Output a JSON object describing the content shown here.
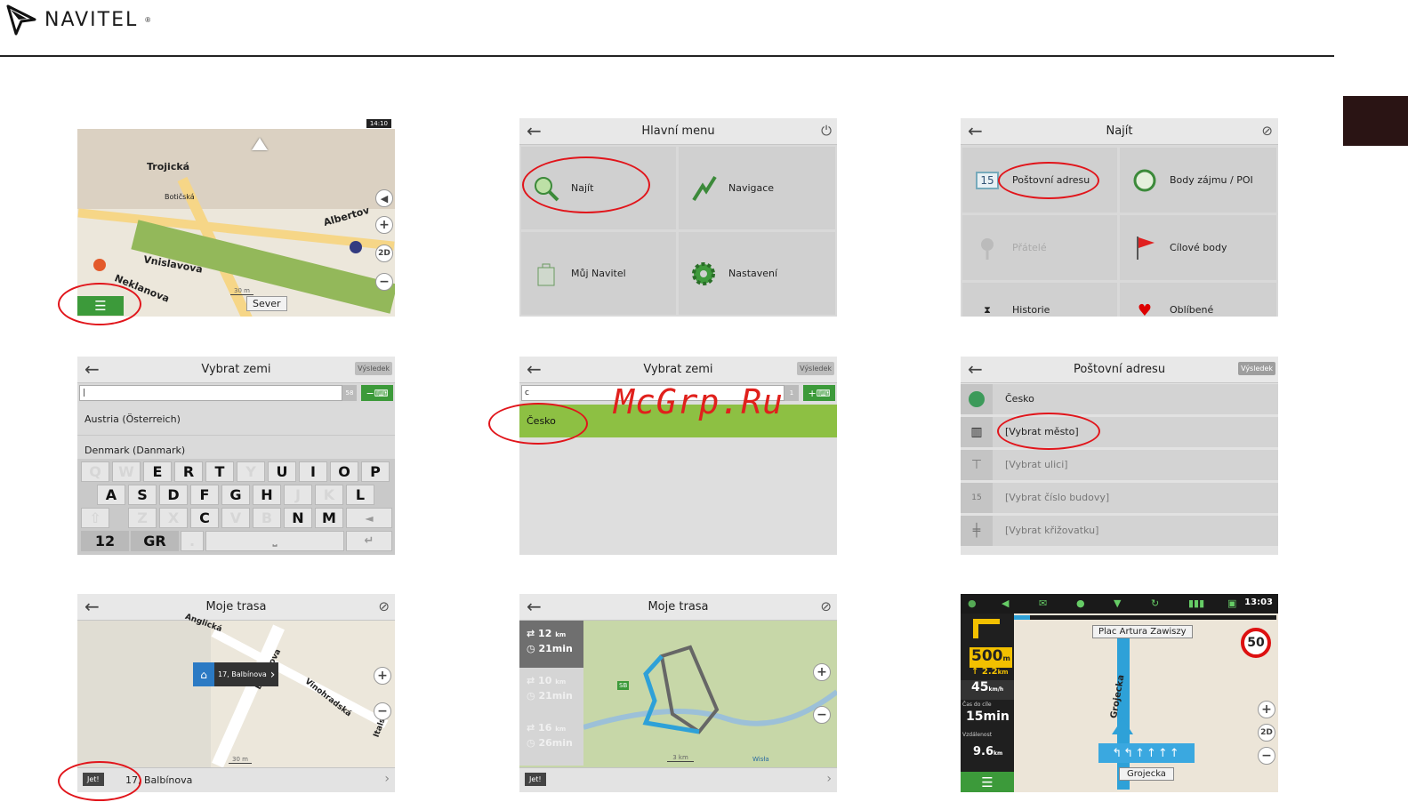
{
  "brand": {
    "name": "NAVITEL",
    "reg": "®"
  },
  "watermark": "McGrp.Ru",
  "p1": {
    "status_time": "14:10",
    "labels": [
      "Trojická",
      "Albertov",
      "Vnislavova",
      "Neklanova",
      "Botičská"
    ],
    "scale": "30 m",
    "sever": "Sever",
    "btn_2d": "2D"
  },
  "p2": {
    "title": "Hlavní menu",
    "tiles": [
      "Najít",
      "Navigace",
      "Můj Navitel",
      "Nastavení"
    ]
  },
  "p3": {
    "title": "Najít",
    "tiles": [
      "Poštovní adresu",
      "Body zájmu / POI",
      "Přátelé",
      "Cílové body",
      "Historie",
      "Oblíbené"
    ],
    "badge": "15"
  },
  "p4": {
    "title": "Vybrat zemi",
    "result_btn": "Výsledek",
    "input": "|",
    "count": "58",
    "items": [
      "Austria (Österreich)",
      "Denmark (Danmark)"
    ],
    "rows": [
      [
        "Q",
        "W",
        "E",
        "R",
        "T",
        "Y",
        "U",
        "I",
        "O",
        "P"
      ],
      [
        "A",
        "S",
        "D",
        "F",
        "G",
        "H",
        "J",
        "K",
        "L"
      ],
      [
        "⇧",
        "Z",
        "X",
        "C",
        "V",
        "B",
        "N",
        "M",
        "◄"
      ],
      [
        "12",
        "GR",
        ".",
        "⎵",
        "↵"
      ]
    ]
  },
  "p5": {
    "title": "Vybrat zemi",
    "result_btn": "Výsledek",
    "input": "c",
    "count": "1",
    "item": "Česko"
  },
  "p6": {
    "title": "Poštovní adresu",
    "result_btn": "Výsledek",
    "rows": [
      "Česko",
      "[Vybrat město]",
      "[Vybrat ulici]",
      "[Vybrat číslo budovy]",
      "[Vybrat křižovatku]"
    ]
  },
  "p7": {
    "title": "Moje trasa",
    "popup": "17, Balbínova",
    "labels": [
      "Balbínova",
      "Vinohradská",
      "Italská",
      "Anglická"
    ],
    "go": "Jet!",
    "address": "17, Balbínova",
    "scale": "30 m"
  },
  "p8": {
    "title": "Moje trasa",
    "routes": [
      {
        "dist": "12",
        "unit": "km",
        "time": "21min"
      },
      {
        "dist": "10",
        "unit": "km",
        "time": "21min"
      },
      {
        "dist": "16",
        "unit": "km",
        "time": "26min"
      }
    ],
    "go": "Jet!",
    "scale": "3 km",
    "road": "SB",
    "river": "Wisła"
  },
  "p9": {
    "time": "13:03",
    "street": "Plac Artura Zawiszy",
    "speed_limit": "50",
    "dist_main": "500",
    "dist_unit": "m",
    "dist_next": "2.2",
    "dist_next_unit": "km",
    "speed": "45",
    "speed_unit": "km/h",
    "eta_label": "Čas do cíle",
    "eta": "15min",
    "rem_label": "Vzdálenost",
    "rem": "9.6",
    "rem_unit": "km",
    "road_label": "Grojecka",
    "bottom": "Grojecka",
    "btn_2d": "2D"
  }
}
